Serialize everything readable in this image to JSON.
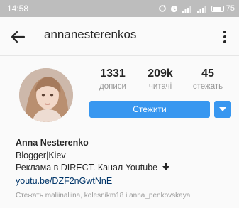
{
  "status_bar": {
    "time": "14:58",
    "battery": "75",
    "icons": [
      "sync-icon",
      "alarm-icon",
      "signal-icon",
      "signal-icon",
      "battery-icon"
    ]
  },
  "app_bar": {
    "username": "annanesterenkos",
    "back_icon": "arrow-left-icon",
    "menu_icon": "more-vertical-icon"
  },
  "profile": {
    "stats": [
      {
        "value": "1331",
        "label": "дописи"
      },
      {
        "value": "209k",
        "label": "читачі"
      },
      {
        "value": "45",
        "label": "стежать"
      }
    ],
    "follow_label": "Стежити",
    "dropdown_icon": "triangle-down-icon"
  },
  "bio": {
    "name": "Anna Nesterenko",
    "line1": "Blogger|Kiev",
    "line2": "Реклама в DIRECT. Канал Youtube",
    "line2_icon": "arrow-down-icon",
    "link": "youtu.be/DZF2nGwtNnE",
    "followed_by": "Стежать maliinaliina, kolesnikm18 і anna_penkovskaya"
  },
  "colors": {
    "accent": "#3897f0",
    "status_bar": "#bdbdbd",
    "link": "#003569",
    "muted": "#999999"
  }
}
